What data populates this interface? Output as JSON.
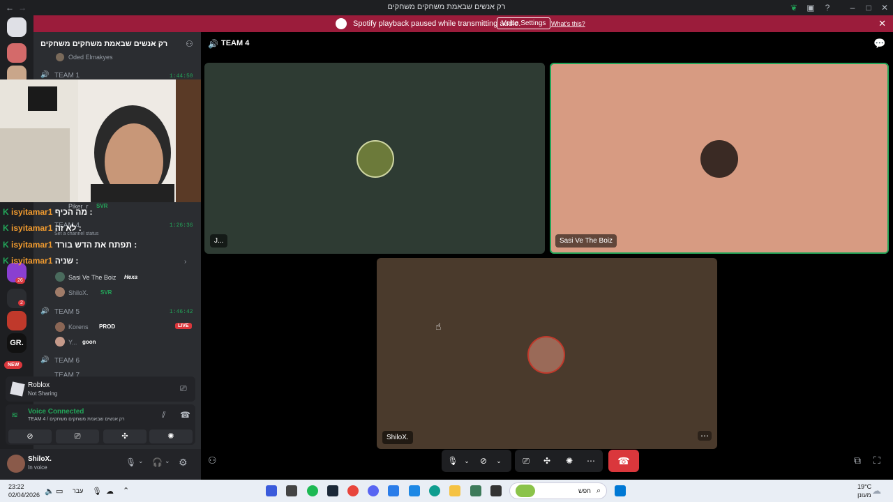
{
  "window": {
    "title": "רק אנשים שבאמת משחקים משחקים"
  },
  "banner": {
    "message": "Spotify playback paused while transmitting audio.",
    "voice_settings": "Voice Settings",
    "whats_this": "What's this?"
  },
  "rail": {
    "badge_26": "26",
    "badge_2": "2",
    "gr_label": "GR.",
    "new_badge": "NEW"
  },
  "sidebar": {
    "server_name": "רק אנשים שבאמת משחקים משחקים",
    "top_user": "Oded Elmakyes",
    "team1": {
      "name": "TEAM 1",
      "time": "1:44:50"
    },
    "pikerUser": {
      "name": "Piker_r",
      "tag": "SVR"
    },
    "team4": {
      "name": "TEAM 4",
      "time": "1:26:36",
      "status": "Set a channel status"
    },
    "team4_users": [
      {
        "name": "Sasi Ve The Boiz",
        "tag": "Hexa"
      },
      {
        "name": "ShiloX.",
        "tag": "SVR"
      }
    ],
    "team5": {
      "name": "TEAM 5",
      "time": "1:46:42"
    },
    "team5_users": [
      {
        "name": "Korens",
        "tag": "PROD",
        "live": "LIVE"
      },
      {
        "name": "Y...",
        "tag": "goon"
      }
    ],
    "team6": {
      "name": "TEAM 6"
    },
    "team7": {
      "name": "TEAM 7"
    }
  },
  "chat_overlay": [
    {
      "user": "isyitamar1",
      "text": "מה הכיף :"
    },
    {
      "user": "isyitamar1",
      "text": "לא זה :"
    },
    {
      "user": "isyitamar1",
      "text": "תפתח את הדש בורד :"
    },
    {
      "user": "isyitamar1",
      "text": "שניה :"
    }
  ],
  "activity": {
    "game": "Roblox",
    "status": "Not Sharing"
  },
  "voice": {
    "status": "Voice Connected",
    "channel": "TEAM 4 / רק אנשים שבאמת משחקים משחקים"
  },
  "user": {
    "name": "ShiloX.",
    "status": "In voice"
  },
  "main": {
    "channel": "TEAM 4",
    "tiles": [
      {
        "name": "J...",
        "color": "#2e3b33"
      },
      {
        "name": "Sasi Ve The Boiz",
        "color": "#d79b82"
      },
      {
        "name": "ShiloX.",
        "color": "#4a3a2c"
      }
    ]
  },
  "taskbar": {
    "time": "23:22",
    "date": "02/04/2026",
    "lang": "עבר",
    "search": "חפש",
    "weather_temp": "19°C",
    "weather_desc": "מעונן"
  },
  "colors": {
    "accent_green": "#23a559",
    "banner_red": "#9b1c3b",
    "leave_red": "#da373c"
  }
}
